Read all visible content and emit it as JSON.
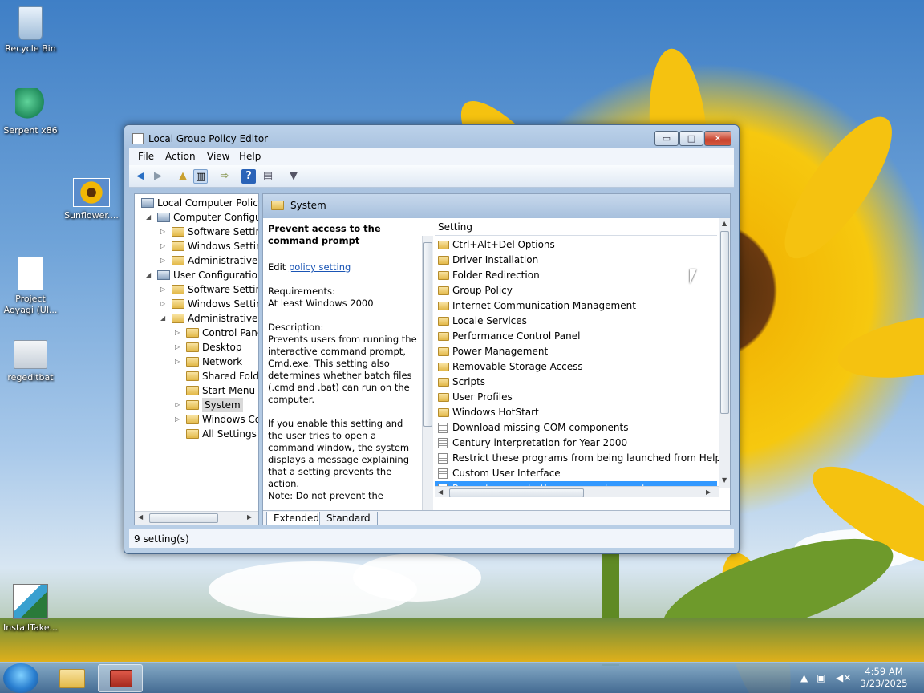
{
  "desktop": {
    "icons": [
      {
        "label": "Recycle Bin",
        "icon": "recycle-bin-icon"
      },
      {
        "label": "Serpent x86",
        "icon": "serpent-icon"
      },
      {
        "label": "Sunflower....",
        "icon": "image-icon"
      },
      {
        "label": "Project Aoyagi (Ul...",
        "icon": "document-icon"
      },
      {
        "label": "regeditbat",
        "icon": "batch-file-icon"
      },
      {
        "label": "InstallTake...",
        "icon": "installer-icon"
      }
    ]
  },
  "window": {
    "title": "Local Group Policy Editor",
    "controls": {
      "minimize": "▭",
      "maximize": "□",
      "close": "✕"
    },
    "menu": [
      "File",
      "Action",
      "View",
      "Help"
    ],
    "tree": [
      {
        "label": "Local Computer Policy",
        "level": 0,
        "toggle": ""
      },
      {
        "label": "Computer Configura",
        "level": 1,
        "toggle": "◢"
      },
      {
        "label": "Software Settings",
        "level": 2,
        "toggle": "▷"
      },
      {
        "label": "Windows Setting",
        "level": 2,
        "toggle": "▷"
      },
      {
        "label": "Administrative Te",
        "level": 2,
        "toggle": "▷"
      },
      {
        "label": "User Configuration",
        "level": 1,
        "toggle": "◢"
      },
      {
        "label": "Software Settings",
        "level": 2,
        "toggle": "▷"
      },
      {
        "label": "Windows Setting",
        "level": 2,
        "toggle": "▷"
      },
      {
        "label": "Administrative Te",
        "level": 2,
        "toggle": "◢"
      },
      {
        "label": "Control Panel",
        "level": 3,
        "toggle": "▷"
      },
      {
        "label": "Desktop",
        "level": 3,
        "toggle": "▷"
      },
      {
        "label": "Network",
        "level": 3,
        "toggle": "▷"
      },
      {
        "label": "Shared Folder",
        "level": 3,
        "toggle": ""
      },
      {
        "label": "Start Menu ar",
        "level": 3,
        "toggle": ""
      },
      {
        "label": "System",
        "level": 3,
        "toggle": "▷",
        "selected": true
      },
      {
        "label": "Windows Cor",
        "level": 3,
        "toggle": "▷"
      },
      {
        "label": "All Settings",
        "level": 3,
        "toggle": ""
      }
    ],
    "pane_header": "System",
    "description": {
      "title": "Prevent access to the command prompt",
      "edit_prefix": "Edit ",
      "edit_link": "policy setting",
      "requirements_label": "Requirements:",
      "requirements_value": "At least Windows 2000",
      "description_label": "Description:",
      "description_text": "Prevents users from running the interactive command prompt, Cmd.exe. This setting also determines whether batch files (.cmd and .bat) can run on the computer.",
      "enable_text": "If you enable this setting and the user tries to open a command window, the system displays a message explaining that a setting prevents the action.",
      "note_text": "Note: Do not prevent the"
    },
    "list_header": "Setting",
    "settings": [
      {
        "label": "Ctrl+Alt+Del Options",
        "kind": "folder"
      },
      {
        "label": "Driver Installation",
        "kind": "folder"
      },
      {
        "label": "Folder Redirection",
        "kind": "folder"
      },
      {
        "label": "Group Policy",
        "kind": "folder"
      },
      {
        "label": "Internet Communication Management",
        "kind": "folder"
      },
      {
        "label": "Locale Services",
        "kind": "folder"
      },
      {
        "label": "Performance Control Panel",
        "kind": "folder"
      },
      {
        "label": "Power Management",
        "kind": "folder"
      },
      {
        "label": "Removable Storage Access",
        "kind": "folder"
      },
      {
        "label": "Scripts",
        "kind": "folder"
      },
      {
        "label": "User Profiles",
        "kind": "folder"
      },
      {
        "label": "Windows HotStart",
        "kind": "folder"
      },
      {
        "label": "Download missing COM components",
        "kind": "setting"
      },
      {
        "label": "Century interpretation for Year 2000",
        "kind": "setting"
      },
      {
        "label": "Restrict these programs from being launched from Help",
        "kind": "setting"
      },
      {
        "label": "Custom User Interface",
        "kind": "setting"
      },
      {
        "label": "Prevent access to the command prompt",
        "kind": "setting",
        "selected": true
      }
    ],
    "tabs": [
      "Extended",
      "Standard"
    ],
    "status": "9 setting(s)"
  },
  "taskbar": {
    "time": "4:59 AM",
    "date": "3/23/2025"
  }
}
